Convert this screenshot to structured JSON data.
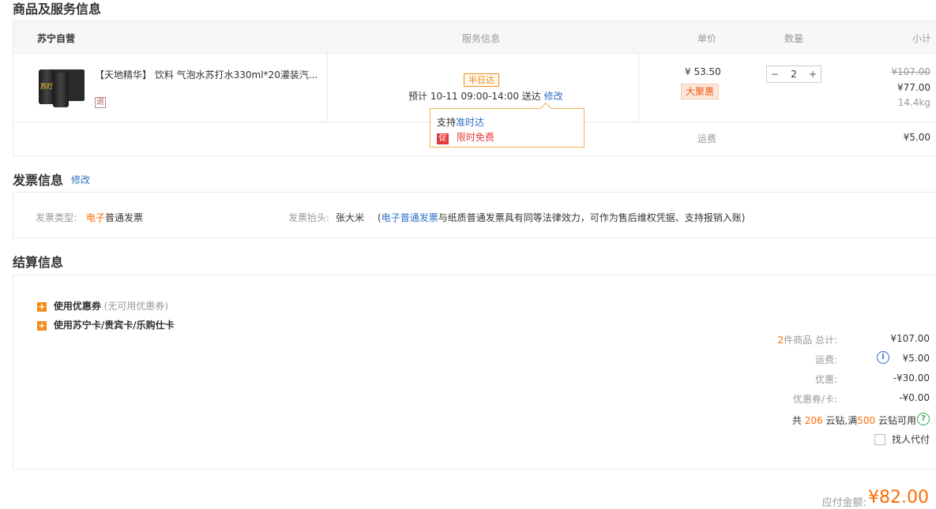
{
  "goods": {
    "title": "商品及服务信息",
    "seller": "苏宁自营",
    "headers": {
      "service": "服务信息",
      "price": "单价",
      "qty": "数量",
      "subtotal": "小计"
    },
    "item": {
      "name": "【天地精华】 饮料 气泡水苏打水330ml*20灌装汽...",
      "return_badge": "退",
      "can_text": "苏打",
      "service_badge": "半日达",
      "delivery_prefix": "预计 10-11 09:00-14:00 送达",
      "modify": "修改",
      "unit_price": "¥ 53.50",
      "promo_badge": "大聚惠",
      "qty": "2",
      "qty_minus": "−",
      "qty_plus": "+",
      "original_total": "¥107.00",
      "total": "¥77.00",
      "weight": "14.4kg"
    },
    "tooltip": {
      "support_prefix": "支持",
      "support_link": "准时达",
      "promo_icon": "促",
      "promo_text": "限时免费"
    },
    "shipping_label": "运费",
    "shipping_value": "¥5.00"
  },
  "invoice": {
    "title": "发票信息",
    "modify": "修改",
    "type_label": "发票类型:",
    "type_highlight": "电子",
    "type_rest": "普通发票",
    "header_label": "发票抬头:",
    "header_value": "张大米",
    "note_open": "(",
    "note_link": "电子普通发票",
    "note_rest": "与纸质普通发票具有同等法律效力，可作为售后维权凭据、支持报销入账)"
  },
  "settlement": {
    "title": "结算信息",
    "coupon_label": "使用优惠券",
    "coupon_note": "(无可用优惠券)",
    "card_label": "使用苏宁卡/贵宾卡/乐购仕卡",
    "count": "2",
    "count_label": "件商品 总计:",
    "total": "¥107.00",
    "shipping_label": "运费:",
    "shipping": "¥5.00",
    "discount_label": "优惠:",
    "discount": "-¥30.00",
    "coupon_card_label": "优惠券/卡:",
    "coupon_card": "-¥0.00",
    "diamond_prefix": "共",
    "diamond_total": "206",
    "diamond_mid": "云钻,满",
    "diamond_min": "500",
    "diamond_suffix": "云钻可用",
    "proxy_label": "找人代付",
    "payable_label": "应付金额:",
    "payable": "¥82.00"
  }
}
